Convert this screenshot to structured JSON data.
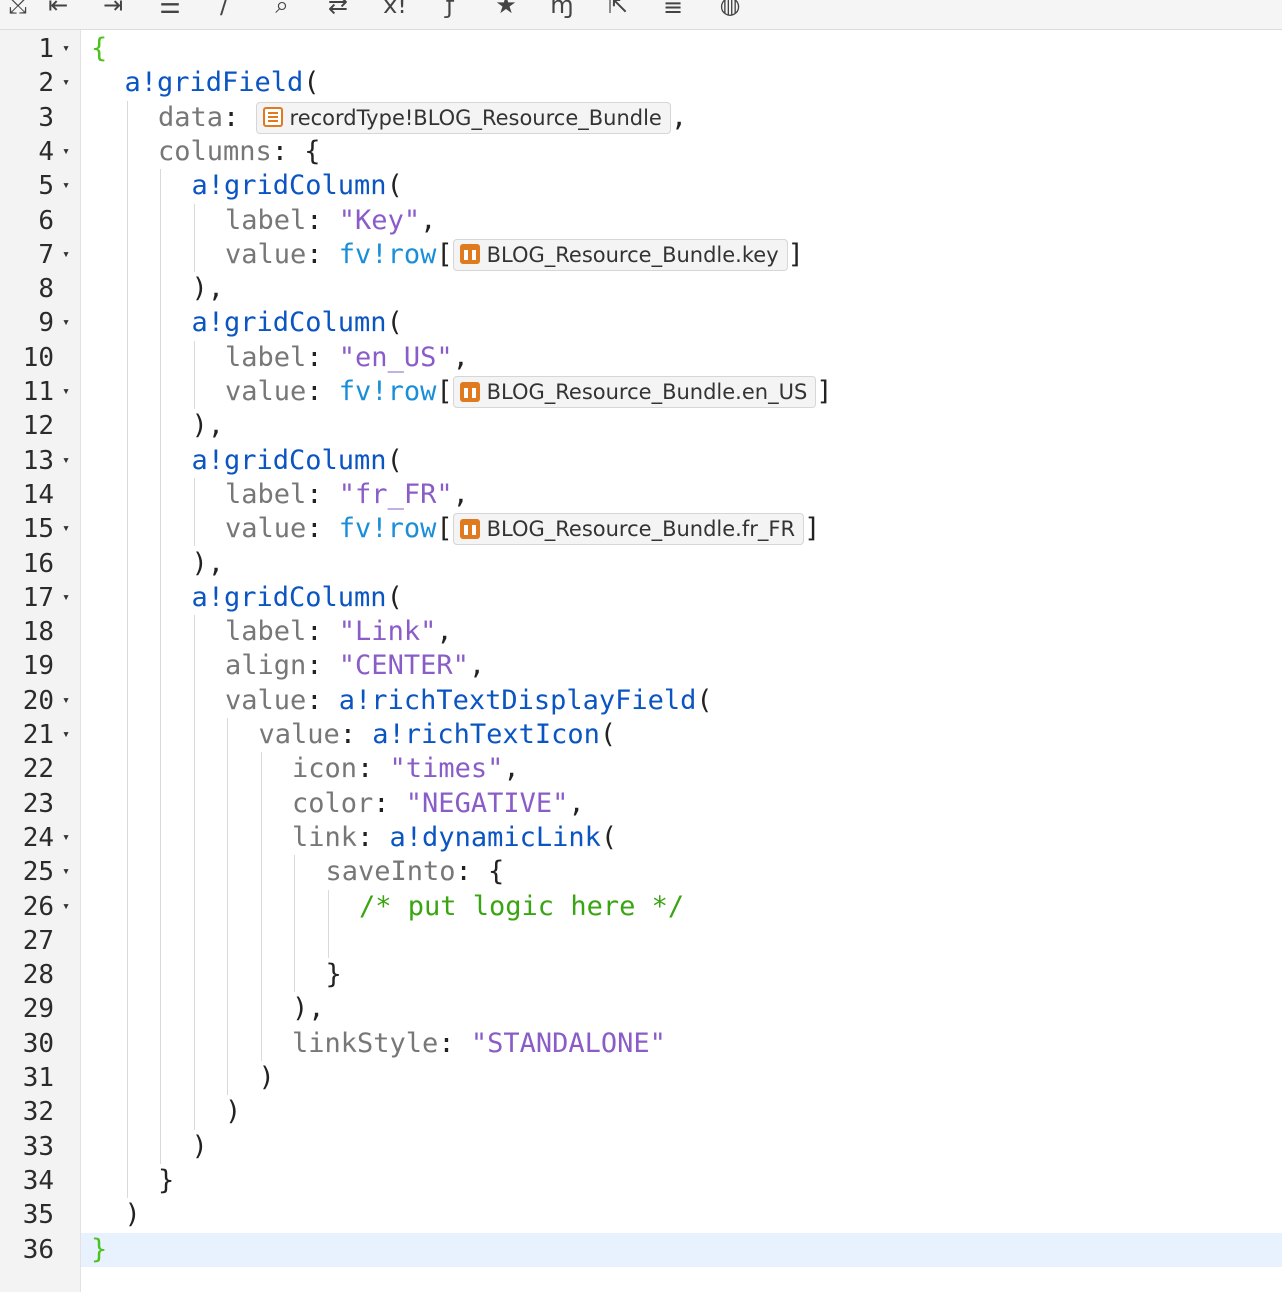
{
  "toolbar": {
    "icons": [
      {
        "name": "format-icon",
        "glyph": "⤩"
      },
      {
        "name": "outdent-icon",
        "glyph": "⇤"
      },
      {
        "name": "indent-icon",
        "glyph": "⇥"
      },
      {
        "name": "list-icon",
        "glyph": "☰"
      },
      {
        "name": "comment-icon",
        "glyph": "/"
      },
      {
        "name": "search-icon",
        "glyph": "⌕"
      },
      {
        "name": "replace-icon",
        "glyph": "⇄"
      },
      {
        "name": "variable-icon",
        "glyph": "x!"
      },
      {
        "name": "function-icon",
        "glyph": "ƒ"
      },
      {
        "name": "favorite-icon",
        "glyph": "★"
      },
      {
        "name": "rule-icon",
        "glyph": "ɱ"
      },
      {
        "name": "export-icon",
        "glyph": "⇱"
      },
      {
        "name": "find-icon",
        "glyph": "≣"
      },
      {
        "name": "web-icon",
        "glyph": "◍"
      }
    ]
  },
  "gutter": {
    "line_numbers": [
      "1",
      "2",
      "3",
      "4",
      "5",
      "6",
      "7",
      "8",
      "9",
      "10",
      "11",
      "12",
      "13",
      "14",
      "15",
      "16",
      "17",
      "18",
      "19",
      "20",
      "21",
      "22",
      "23",
      "24",
      "25",
      "26",
      "27",
      "28",
      "29",
      "30",
      "31",
      "32",
      "33",
      "34",
      "35",
      "36"
    ],
    "fold_marker": "▾",
    "foldable_lines": [
      1,
      2,
      4,
      5,
      7,
      9,
      11,
      13,
      15,
      17,
      20,
      21,
      24,
      25,
      26
    ]
  },
  "editor": {
    "active_line": 36,
    "lines": [
      {
        "indent": 0,
        "tokens": [
          {
            "t": "g",
            "v": "{"
          }
        ]
      },
      {
        "indent": 1,
        "tokens": [
          {
            "t": "fn",
            "v": "a!gridField"
          },
          {
            "t": "p",
            "v": "("
          }
        ]
      },
      {
        "indent": 2,
        "tokens": [
          {
            "t": "k",
            "v": "data"
          },
          {
            "t": "p",
            "v": ": "
          },
          {
            "t": "chip",
            "icon": "rec",
            "v": "recordType!BLOG_Resource_Bundle"
          },
          {
            "t": "p",
            "v": ","
          }
        ]
      },
      {
        "indent": 2,
        "tokens": [
          {
            "t": "k",
            "v": "columns"
          },
          {
            "t": "p",
            "v": ": {"
          }
        ]
      },
      {
        "indent": 3,
        "tokens": [
          {
            "t": "fn",
            "v": "a!gridColumn"
          },
          {
            "t": "p",
            "v": "("
          }
        ]
      },
      {
        "indent": 4,
        "tokens": [
          {
            "t": "k",
            "v": "label"
          },
          {
            "t": "p",
            "v": ": "
          },
          {
            "t": "s",
            "v": "\"Key\""
          },
          {
            "t": "p",
            "v": ","
          }
        ]
      },
      {
        "indent": 4,
        "tokens": [
          {
            "t": "k",
            "v": "value"
          },
          {
            "t": "p",
            "v": ": "
          },
          {
            "t": "fv",
            "v": "fv!row"
          },
          {
            "t": "p",
            "v": "["
          },
          {
            "t": "chip",
            "icon": "fld",
            "v": "BLOG_Resource_Bundle.key"
          },
          {
            "t": "p",
            "v": "]"
          }
        ]
      },
      {
        "indent": 3,
        "tokens": [
          {
            "t": "p",
            "v": "),"
          }
        ]
      },
      {
        "indent": 3,
        "tokens": [
          {
            "t": "fn",
            "v": "a!gridColumn"
          },
          {
            "t": "p",
            "v": "("
          }
        ]
      },
      {
        "indent": 4,
        "tokens": [
          {
            "t": "k",
            "v": "label"
          },
          {
            "t": "p",
            "v": ": "
          },
          {
            "t": "s",
            "v": "\"en_US\""
          },
          {
            "t": "p",
            "v": ","
          }
        ]
      },
      {
        "indent": 4,
        "tokens": [
          {
            "t": "k",
            "v": "value"
          },
          {
            "t": "p",
            "v": ": "
          },
          {
            "t": "fv",
            "v": "fv!row"
          },
          {
            "t": "p",
            "v": "["
          },
          {
            "t": "chip",
            "icon": "fld",
            "v": "BLOG_Resource_Bundle.en_US"
          },
          {
            "t": "p",
            "v": "]"
          }
        ]
      },
      {
        "indent": 3,
        "tokens": [
          {
            "t": "p",
            "v": "),"
          }
        ]
      },
      {
        "indent": 3,
        "tokens": [
          {
            "t": "fn",
            "v": "a!gridColumn"
          },
          {
            "t": "p",
            "v": "("
          }
        ]
      },
      {
        "indent": 4,
        "tokens": [
          {
            "t": "k",
            "v": "label"
          },
          {
            "t": "p",
            "v": ": "
          },
          {
            "t": "s",
            "v": "\"fr_FR\""
          },
          {
            "t": "p",
            "v": ","
          }
        ]
      },
      {
        "indent": 4,
        "tokens": [
          {
            "t": "k",
            "v": "value"
          },
          {
            "t": "p",
            "v": ": "
          },
          {
            "t": "fv",
            "v": "fv!row"
          },
          {
            "t": "p",
            "v": "["
          },
          {
            "t": "chip",
            "icon": "fld",
            "v": "BLOG_Resource_Bundle.fr_FR"
          },
          {
            "t": "p",
            "v": "]"
          }
        ]
      },
      {
        "indent": 3,
        "tokens": [
          {
            "t": "p",
            "v": "),"
          }
        ]
      },
      {
        "indent": 3,
        "tokens": [
          {
            "t": "fn",
            "v": "a!gridColumn"
          },
          {
            "t": "p",
            "v": "("
          }
        ]
      },
      {
        "indent": 4,
        "tokens": [
          {
            "t": "k",
            "v": "label"
          },
          {
            "t": "p",
            "v": ": "
          },
          {
            "t": "s",
            "v": "\"Link\""
          },
          {
            "t": "p",
            "v": ","
          }
        ]
      },
      {
        "indent": 4,
        "tokens": [
          {
            "t": "k",
            "v": "align"
          },
          {
            "t": "p",
            "v": ": "
          },
          {
            "t": "s",
            "v": "\"CENTER\""
          },
          {
            "t": "p",
            "v": ","
          }
        ]
      },
      {
        "indent": 4,
        "tokens": [
          {
            "t": "k",
            "v": "value"
          },
          {
            "t": "p",
            "v": ": "
          },
          {
            "t": "fn",
            "v": "a!richTextDisplayField"
          },
          {
            "t": "p",
            "v": "("
          }
        ]
      },
      {
        "indent": 5,
        "tokens": [
          {
            "t": "k",
            "v": "value"
          },
          {
            "t": "p",
            "v": ": "
          },
          {
            "t": "fn",
            "v": "a!richTextIcon"
          },
          {
            "t": "p",
            "v": "("
          }
        ]
      },
      {
        "indent": 6,
        "tokens": [
          {
            "t": "k",
            "v": "icon"
          },
          {
            "t": "p",
            "v": ": "
          },
          {
            "t": "s",
            "v": "\"times\""
          },
          {
            "t": "p",
            "v": ","
          }
        ]
      },
      {
        "indent": 6,
        "tokens": [
          {
            "t": "k",
            "v": "color"
          },
          {
            "t": "p",
            "v": ": "
          },
          {
            "t": "s",
            "v": "\"NEGATIVE\""
          },
          {
            "t": "p",
            "v": ","
          }
        ]
      },
      {
        "indent": 6,
        "tokens": [
          {
            "t": "k",
            "v": "link"
          },
          {
            "t": "p",
            "v": ": "
          },
          {
            "t": "fn",
            "v": "a!dynamicLink"
          },
          {
            "t": "p",
            "v": "("
          }
        ]
      },
      {
        "indent": 7,
        "tokens": [
          {
            "t": "k",
            "v": "saveInto"
          },
          {
            "t": "p",
            "v": ": {"
          }
        ]
      },
      {
        "indent": 8,
        "tokens": [
          {
            "t": "c",
            "v": "/* put logic here */"
          }
        ]
      },
      {
        "indent": 8,
        "tokens": []
      },
      {
        "indent": 7,
        "tokens": [
          {
            "t": "p",
            "v": "}"
          }
        ]
      },
      {
        "indent": 6,
        "tokens": [
          {
            "t": "p",
            "v": "),"
          }
        ]
      },
      {
        "indent": 6,
        "tokens": [
          {
            "t": "k",
            "v": "linkStyle"
          },
          {
            "t": "p",
            "v": ": "
          },
          {
            "t": "s",
            "v": "\"STANDALONE\""
          }
        ]
      },
      {
        "indent": 5,
        "tokens": [
          {
            "t": "p",
            "v": ")"
          }
        ]
      },
      {
        "indent": 4,
        "tokens": [
          {
            "t": "p",
            "v": ")"
          }
        ]
      },
      {
        "indent": 3,
        "tokens": [
          {
            "t": "p",
            "v": ")"
          }
        ]
      },
      {
        "indent": 2,
        "tokens": [
          {
            "t": "p",
            "v": "}"
          }
        ]
      },
      {
        "indent": 1,
        "tokens": [
          {
            "t": "p",
            "v": ")"
          }
        ]
      },
      {
        "indent": 0,
        "tokens": [
          {
            "t": "g",
            "v": "}"
          }
        ]
      }
    ]
  },
  "colors": {
    "function": "#0a55c2",
    "key": "#777777",
    "string": "#8a5cc8",
    "fv": "#1a8fd8",
    "comment": "#39a512",
    "brace_green": "#4cc21c",
    "chip_icon": "#e07a1e",
    "active_line": "#e8f2ff"
  }
}
